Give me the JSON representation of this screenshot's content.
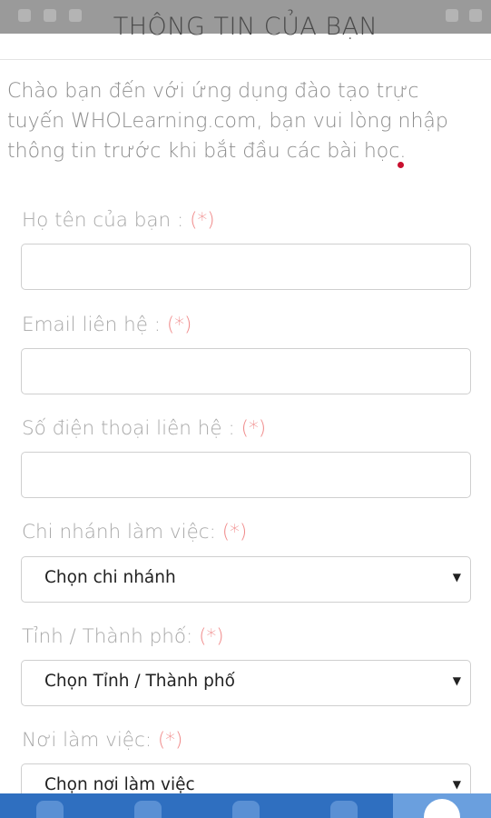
{
  "header": {
    "title": "THÔNG TIN CỦA BẠN"
  },
  "intro": {
    "text": "Chào bạn đến với ứng dụng đào tạo trực tuyến WHOLearning.com, bạn vui lòng nhập thông tin trước khi bắt đầu các bài học."
  },
  "form": {
    "required_mark": "(*)",
    "fullname": {
      "label": "Họ tên của bạn :",
      "value": ""
    },
    "email": {
      "label": "Email liên hệ :",
      "value": ""
    },
    "phone": {
      "label": "Số điện thoại liên hệ :",
      "value": ""
    },
    "branch": {
      "label": "Chi nhánh làm việc:",
      "selected": "Chọn chi nhánh"
    },
    "province": {
      "label": "Tỉnh / Thành phố:",
      "selected": "Chọn Tỉnh / Thành phố"
    },
    "workplace": {
      "label": "Nơi làm việc:",
      "selected": "Chọn nơi làm việc"
    },
    "caret": "▼"
  },
  "bottom_nav": {
    "items": [
      {
        "icon": "home-icon"
      },
      {
        "icon": "book-icon"
      },
      {
        "icon": "graduation-cap-icon"
      },
      {
        "icon": "chat-icon"
      },
      {
        "icon": "user-icon",
        "active": true
      }
    ]
  },
  "colors": {
    "accent": "#2f6fc0",
    "required": "#f08a8a",
    "status_bar": "#9a9a9a"
  }
}
